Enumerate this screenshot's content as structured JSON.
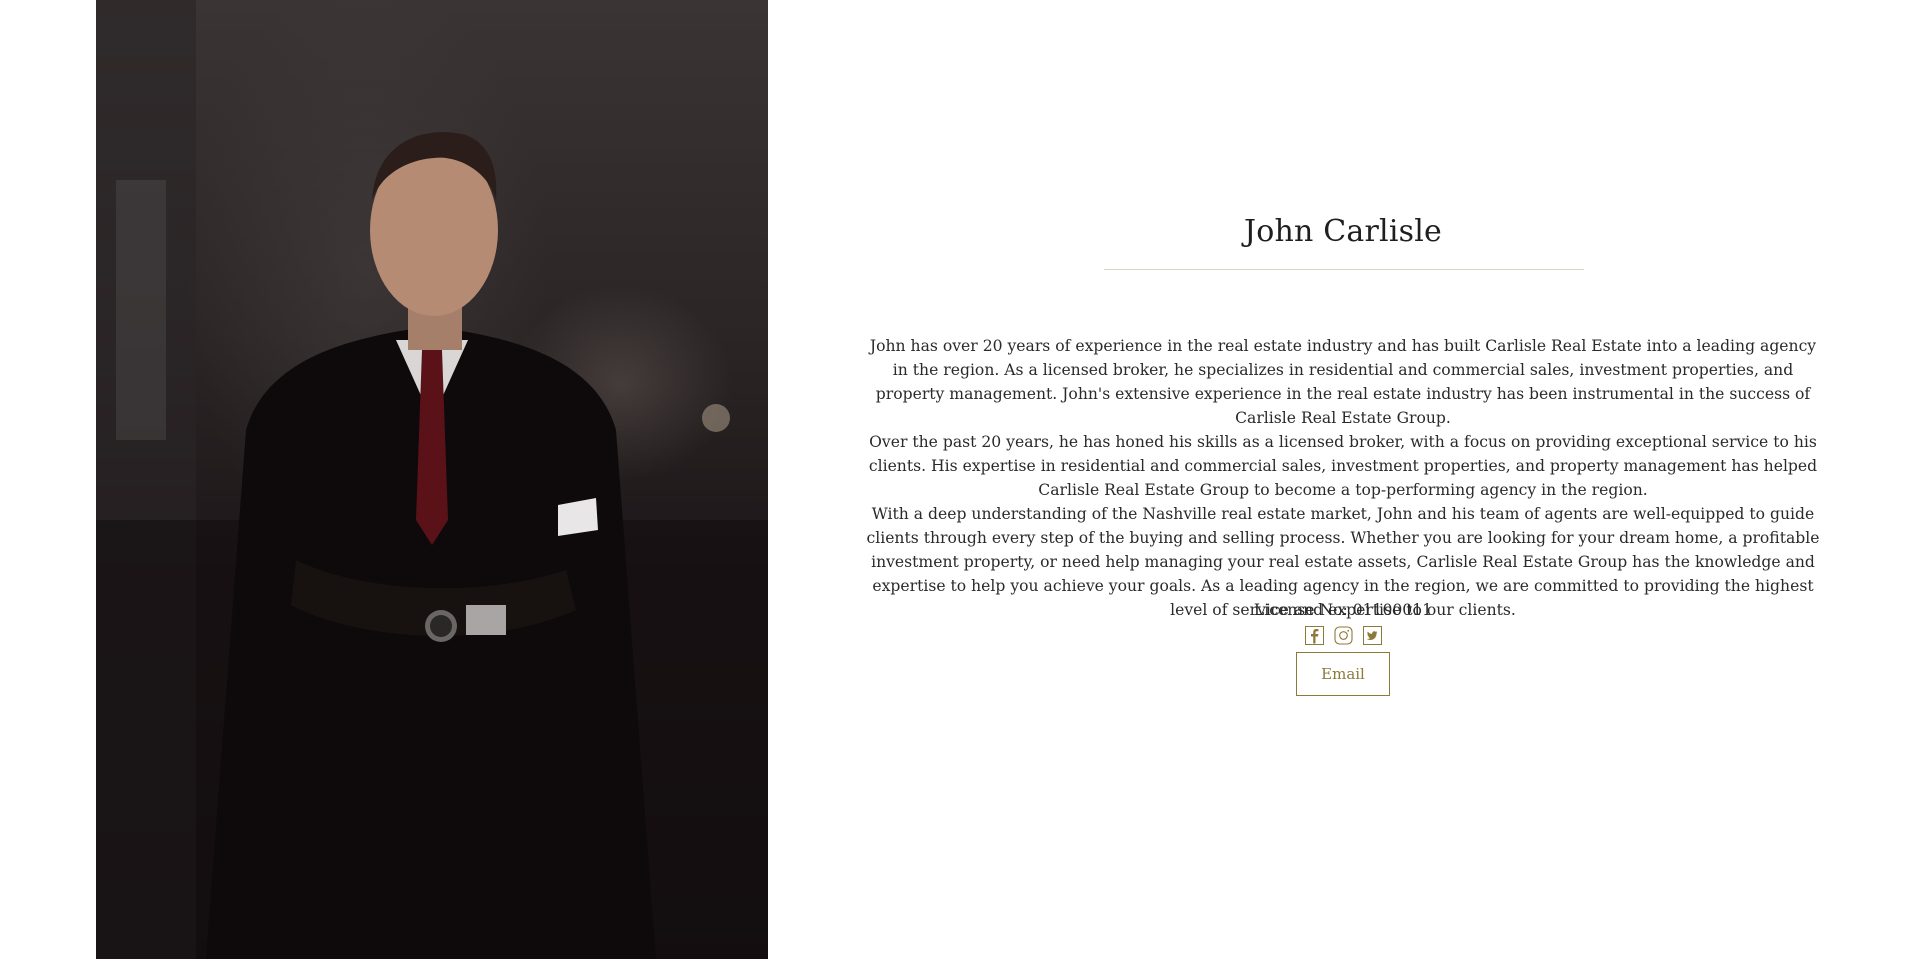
{
  "profile": {
    "name": "John Carlisle",
    "photo_alt": "portrait",
    "bio": [
      "John has over 20 years of experience in the real estate industry and has built Carlisle Real Estate into a leading agency in the region. As a licensed broker, he specializes in residential and commercial sales, investment properties, and property management. John's extensive experience in the real estate industry has been instrumental in the success of Carlisle Real Estate Group.",
      "Over the past 20 years, he has honed his skills as a licensed broker, with a focus on providing exceptional service to his clients. His expertise in residential and commercial sales, investment properties, and property management has helped Carlisle Real Estate Group to become a top-performing agency in the region.",
      "With a deep understanding of the Nashville real estate market, John and his team of agents are well-equipped to guide clients through every step of the buying and selling process. Whether you are looking for your dream home, a profitable investment property, or need help managing your real estate assets, Carlisle Real Estate Group has the knowledge and expertise to help you achieve your goals. As a leading agency in the region, we are committed to providing the highest level of service and expertise to our clients."
    ],
    "license": "License No: 01100011",
    "email_label": "Email"
  },
  "social": [
    {
      "icon": "facebook-icon"
    },
    {
      "icon": "instagram-icon"
    },
    {
      "icon": "twitter-icon"
    }
  ],
  "colors": {
    "accent": "#8c7a3a",
    "divider": "#d8d4c6",
    "text": "#2a2a2a",
    "background": "#ffffff"
  }
}
